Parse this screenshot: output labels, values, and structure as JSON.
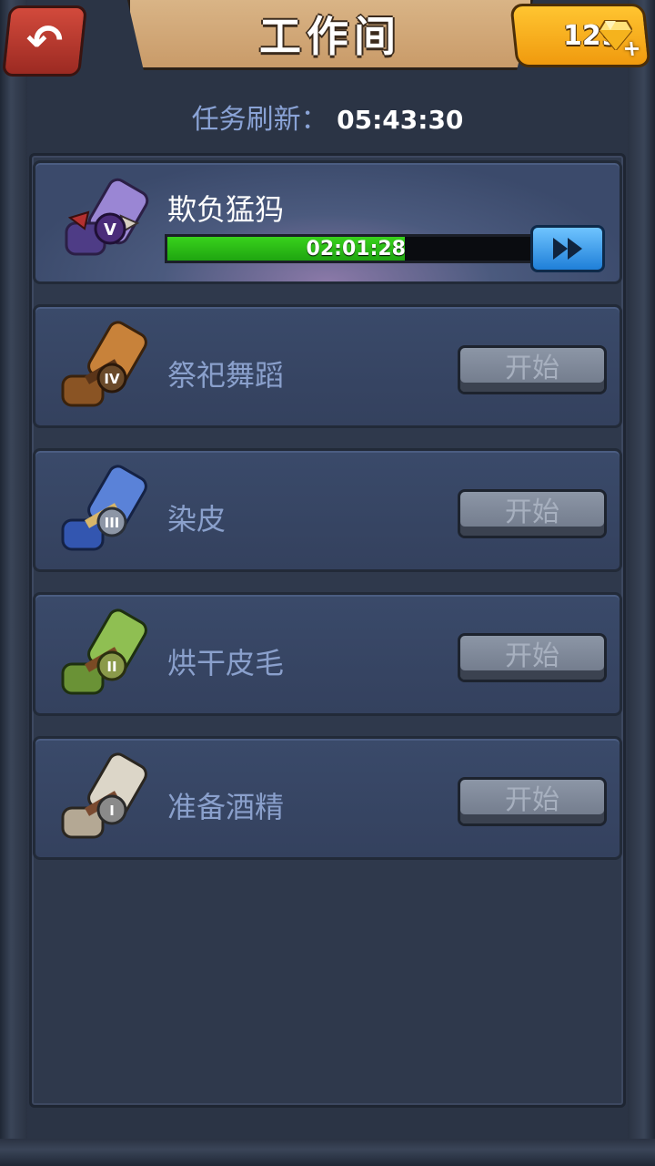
{
  "header": {
    "title": "工作间",
    "gems": "129"
  },
  "refresh": {
    "label": "任务刷新：",
    "time": "05:43:30"
  },
  "tasks": [
    {
      "name": "欺负猛犸",
      "level": "V",
      "status": "active",
      "timer": "02:01:28",
      "progress": 0.64,
      "color": "#8a72c8"
    },
    {
      "name": "祭祀舞蹈",
      "level": "IV",
      "status": "idle",
      "button": "开始",
      "color": "#c8823a"
    },
    {
      "name": "染皮",
      "level": "III",
      "status": "idle",
      "button": "开始",
      "color": "#4a6fc8"
    },
    {
      "name": "烘干皮毛",
      "level": "II",
      "status": "idle",
      "button": "开始",
      "color": "#7aa63e"
    },
    {
      "name": "准备酒精",
      "level": "I",
      "status": "idle",
      "button": "开始",
      "color": "#c9c2b2"
    }
  ]
}
